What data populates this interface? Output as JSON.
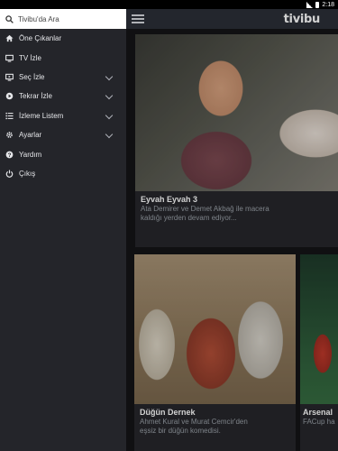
{
  "status_bar": {
    "time": "2:18"
  },
  "app": {
    "logo": "tivibu"
  },
  "search": {
    "placeholder": "Tivibu'da Ara"
  },
  "menu": [
    {
      "label": "Öne Çıkanlar",
      "icon": "home-icon"
    },
    {
      "label": "TV İzle",
      "icon": "tv-icon"
    },
    {
      "label": "Seç İzle",
      "icon": "screen-play-icon",
      "expandable": true
    },
    {
      "label": "Tekrar İzle",
      "icon": "replay-icon",
      "expandable": true
    },
    {
      "label": "İzleme Listem",
      "icon": "list-icon",
      "expandable": true
    },
    {
      "label": "Ayarlar",
      "icon": "gear-icon",
      "expandable": true
    },
    {
      "label": "Yardım",
      "icon": "help-icon"
    },
    {
      "label": "Çıkış",
      "icon": "power-icon"
    }
  ],
  "cards": [
    {
      "title": "Eyvah Eyvah 3",
      "line1": "Ata Demirer ve Demet Akbağ ile macera",
      "line2": "kaldığı yerden devam ediyor..."
    },
    {
      "title": "Düğün Dernek",
      "line1": "Ahmet Kural ve Murat Cemcir'den",
      "line2": "eşsiz bir düğün komedisi."
    },
    {
      "title": "Arsenal",
      "line1": "FACup ha"
    }
  ]
}
